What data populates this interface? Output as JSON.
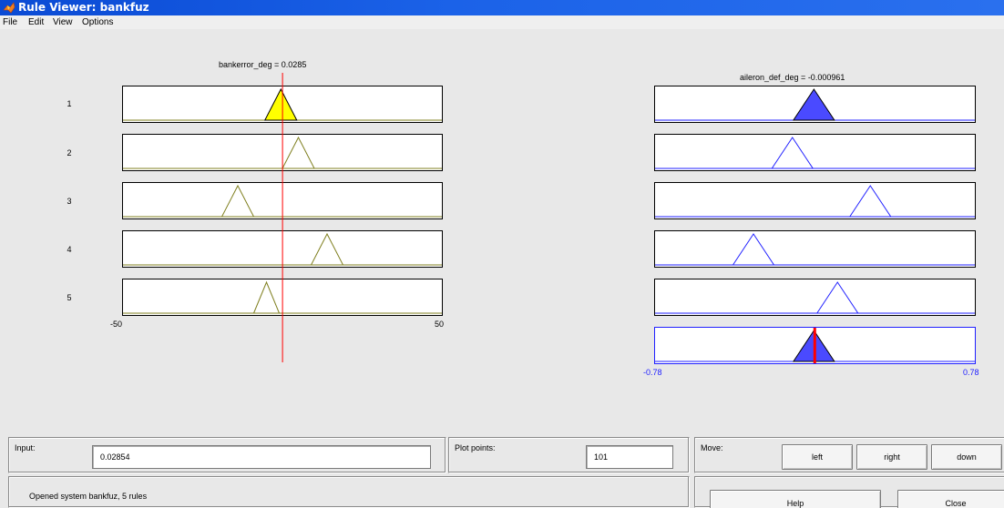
{
  "window": {
    "title": "Rule Viewer: bankfuz",
    "icon": "matlab-icon"
  },
  "menu": [
    "File",
    "Edit",
    "View",
    "Options"
  ],
  "input_plots": {
    "header": "bankerror_deg = 0.0285",
    "axis_min": "-50",
    "axis_max": "50",
    "range": [
      -50,
      50
    ],
    "input_value": 0.0285,
    "rules": [
      {
        "label": "1",
        "center": -0.5,
        "halfwidth": 5,
        "filled": true
      },
      {
        "label": "2",
        "center": 5,
        "halfwidth": 5,
        "filled": false
      },
      {
        "label": "3",
        "center": -14,
        "halfwidth": 5,
        "filled": false
      },
      {
        "label": "4",
        "center": 14,
        "halfwidth": 5,
        "filled": false
      },
      {
        "label": "5",
        "center": -5,
        "halfwidth": 4,
        "filled": false
      }
    ],
    "line_color": "#808020",
    "fill_color": "#ffff00",
    "marker_color": "#ff0000"
  },
  "output_plots": {
    "header": "aileron_def_deg = -0.000961",
    "axis_min": "-0.78",
    "axis_max": "0.78",
    "range": [
      -0.78,
      0.78
    ],
    "output_value": -0.000961,
    "rules": [
      {
        "center": -0.005,
        "halfwidth": 0.1,
        "filled": true
      },
      {
        "center": -0.11,
        "halfwidth": 0.1,
        "filled": false
      },
      {
        "center": 0.27,
        "halfwidth": 0.1,
        "filled": false
      },
      {
        "center": -0.3,
        "halfwidth": 0.1,
        "filled": false
      },
      {
        "center": 0.11,
        "halfwidth": 0.1,
        "filled": false
      }
    ],
    "aggregate": {
      "center": -0.005,
      "halfwidth": 0.1
    },
    "line_color": "#2020ff",
    "fill_color": "#4a4aff",
    "marker_color": "#ff0000"
  },
  "controls": {
    "input_label": "Input:",
    "input_value": "0.02854",
    "plot_points_label": "Plot points:",
    "plot_points_value": "101",
    "move_label": "Move:",
    "move_left": "left",
    "move_right": "right",
    "move_down": "down",
    "status": "Opened system bankfuz, 5 rules",
    "help": "Help",
    "close": "Close"
  }
}
